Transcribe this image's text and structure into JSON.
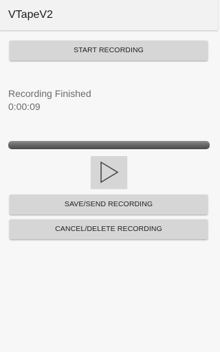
{
  "app": {
    "title": "VTapeV2"
  },
  "buttons": {
    "start_label": "START RECORDING",
    "save_label": "SAVE/SEND RECORDING",
    "cancel_label": "CANCEL/DELETE RECORDING"
  },
  "status": {
    "text": "Recording Finished",
    "duration": "0:00:09"
  },
  "progress": {
    "fraction": 1.0
  },
  "player": {
    "icon": "play-icon"
  },
  "colors": {
    "background": "#f7f7f7",
    "button": "#d6d6d6",
    "status_text": "#6b6b6b"
  }
}
